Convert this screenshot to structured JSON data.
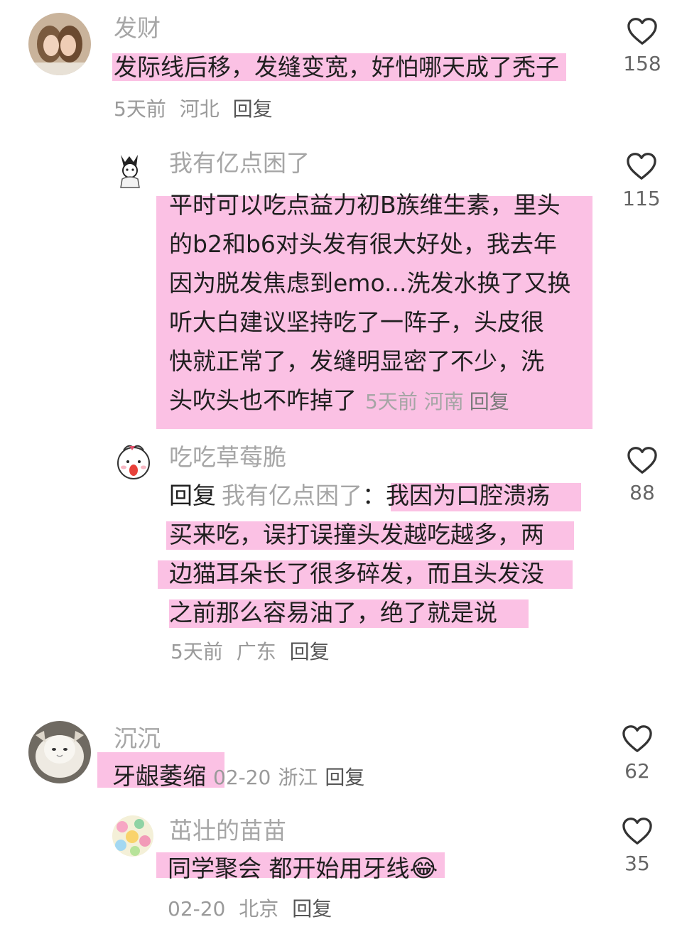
{
  "comments": [
    {
      "username": "发财",
      "text": "发际线后移，发缝变宽，好怕哪天成了秃子",
      "time": "5天前",
      "location": "河北",
      "reply_label": "回复",
      "likes": "158"
    },
    {
      "username": "我有亿点困了",
      "lines": [
        "平时可以吃点益力初B族维生素，里头",
        "的b2和b6对头发有很大好处，我去年",
        "因为脱发焦虑到emo...洗发水换了又换",
        "听大白建议坚持吃了一阵子，头皮很",
        "快就正常了，发缝明显密了不少，洗",
        "头吹头也不咋掉了"
      ],
      "time": "5天前",
      "location": "河南",
      "reply_label": "回复",
      "likes": "115"
    },
    {
      "username": "吃吃草莓脆",
      "reply_prefix": "回复",
      "reply_to": "我有亿点困了",
      "reply_colon": "：",
      "lines": [
        "我因为口腔溃疡",
        "买来吃，误打误撞头发越吃越多，两",
        "边猫耳朵长了很多碎发，而且头发没",
        "之前那么容易油了，绝了就是说"
      ],
      "time": "5天前",
      "location": "广东",
      "reply_label": "回复",
      "likes": "88"
    },
    {
      "username": "沉沉",
      "text": "牙龈萎缩",
      "time": "02-20",
      "location": "浙江",
      "reply_label": "回复",
      "likes": "62"
    },
    {
      "username": "茁壮的苗苗",
      "text": "同学聚会 都开始用牙线",
      "emoji": "😂",
      "time": "02-20",
      "location": "北京",
      "reply_label": "回复",
      "likes": "35"
    }
  ],
  "icons": {
    "like": "heart-outline-icon"
  },
  "colors": {
    "highlight": "#fbc1e4",
    "username": "#a6a6a6",
    "meta": "#9a9a9a"
  }
}
